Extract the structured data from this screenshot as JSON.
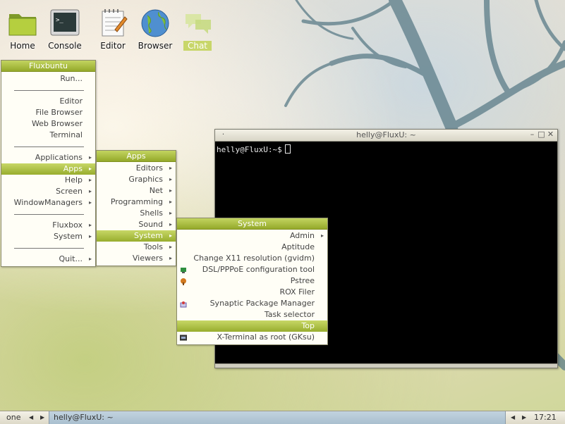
{
  "desktop_icons": [
    {
      "label": "Home",
      "icon": "folder-icon"
    },
    {
      "label": "Console",
      "icon": "terminal-icon"
    },
    {
      "label": "Editor",
      "icon": "notepad-icon"
    },
    {
      "label": "Browser",
      "icon": "globe-icon"
    },
    {
      "label": "Chat",
      "icon": "chat-bubbles-icon",
      "selected": true
    }
  ],
  "root_menu": {
    "title": "Fluxbuntu",
    "items": [
      {
        "label": "Run..."
      },
      {
        "separator": true
      },
      {
        "label": "Editor"
      },
      {
        "label": "File Browser"
      },
      {
        "label": "Web Browser"
      },
      {
        "label": "Terminal"
      },
      {
        "separator": true
      },
      {
        "label": "Applications",
        "submenu": true
      },
      {
        "label": "Apps",
        "submenu": true,
        "highlighted": true
      },
      {
        "label": "Help",
        "submenu": true
      },
      {
        "label": "Screen",
        "submenu": true
      },
      {
        "label": "WindowManagers",
        "submenu": true
      },
      {
        "separator": true
      },
      {
        "label": "Fluxbox",
        "submenu": true
      },
      {
        "label": "System",
        "submenu": true
      },
      {
        "separator": true
      },
      {
        "label": "Quit...",
        "submenu": true
      }
    ]
  },
  "apps_menu": {
    "title": "Apps",
    "items": [
      {
        "label": "Editors",
        "submenu": true
      },
      {
        "label": "Graphics",
        "submenu": true
      },
      {
        "label": "Net",
        "submenu": true
      },
      {
        "label": "Programming",
        "submenu": true
      },
      {
        "label": "Shells",
        "submenu": true
      },
      {
        "label": "Sound",
        "submenu": true
      },
      {
        "label": "System",
        "submenu": true,
        "highlighted": true
      },
      {
        "label": "Tools",
        "submenu": true
      },
      {
        "label": "Viewers",
        "submenu": true
      }
    ]
  },
  "system_menu": {
    "title": "System",
    "items": [
      {
        "label": "Admin",
        "submenu": true
      },
      {
        "label": "Aptitude"
      },
      {
        "label": "Change X11 resolution (gvidm)"
      },
      {
        "label": "DSL/PPPoE configuration tool",
        "icon": "network-config-icon"
      },
      {
        "label": "Pstree",
        "icon": "tree-icon"
      },
      {
        "label": "ROX Filer"
      },
      {
        "label": "Synaptic Package Manager",
        "icon": "package-icon"
      },
      {
        "label": "Task selector"
      },
      {
        "label": "Top",
        "highlighted": true
      },
      {
        "label": "X-Terminal as root (GKsu)",
        "icon": "root-terminal-icon"
      }
    ]
  },
  "terminal": {
    "title": "helly@FluxU: ~",
    "prompt": "helly@FluxU:~$"
  },
  "taskbar": {
    "workspace": "one",
    "task": "helly@FluxU: ~",
    "clock": "17:21"
  },
  "colors": {
    "menu_accent": "#a8bc3a",
    "terminal_bg": "#000000"
  }
}
